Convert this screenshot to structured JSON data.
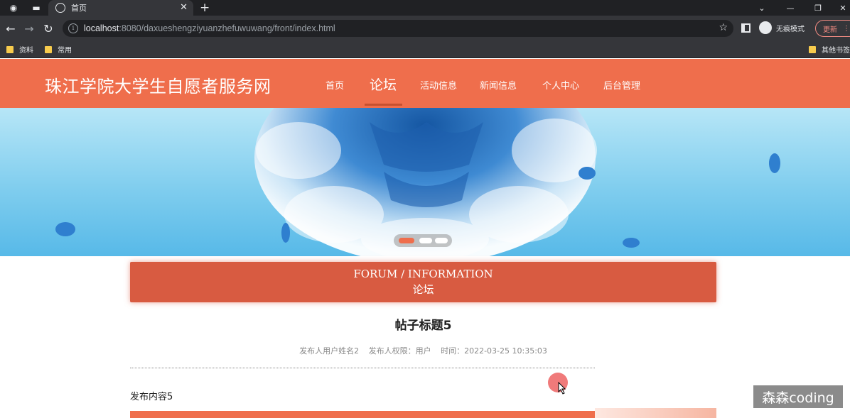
{
  "browser": {
    "tab_title": "首页",
    "url_host": "localhost",
    "url_path": ":8080/daxueshengziyuanzhefuwuwang/front/index.html",
    "incognito_label": "无痕模式",
    "update_label": "更新",
    "bookmarks": [
      "资料",
      "常用"
    ],
    "other_bookmarks": "其他书签"
  },
  "site": {
    "title": "珠江学院大学生自愿者服务网",
    "nav": [
      "首页",
      "论坛",
      "活动信息",
      "新闻信息",
      "个人中心",
      "后台管理"
    ],
    "active_nav": "论坛",
    "accent": "#ef6e4c"
  },
  "section": {
    "heading_en": "FORUM / INFORMATION",
    "heading_cn": "论坛"
  },
  "post": {
    "title": "帖子标题5",
    "author": "发布人用户姓名2",
    "role": "发布人权限：用户",
    "time": "时间：2022-03-25 10:35:03",
    "content": "发布内容5"
  },
  "watermark": "森森coding"
}
